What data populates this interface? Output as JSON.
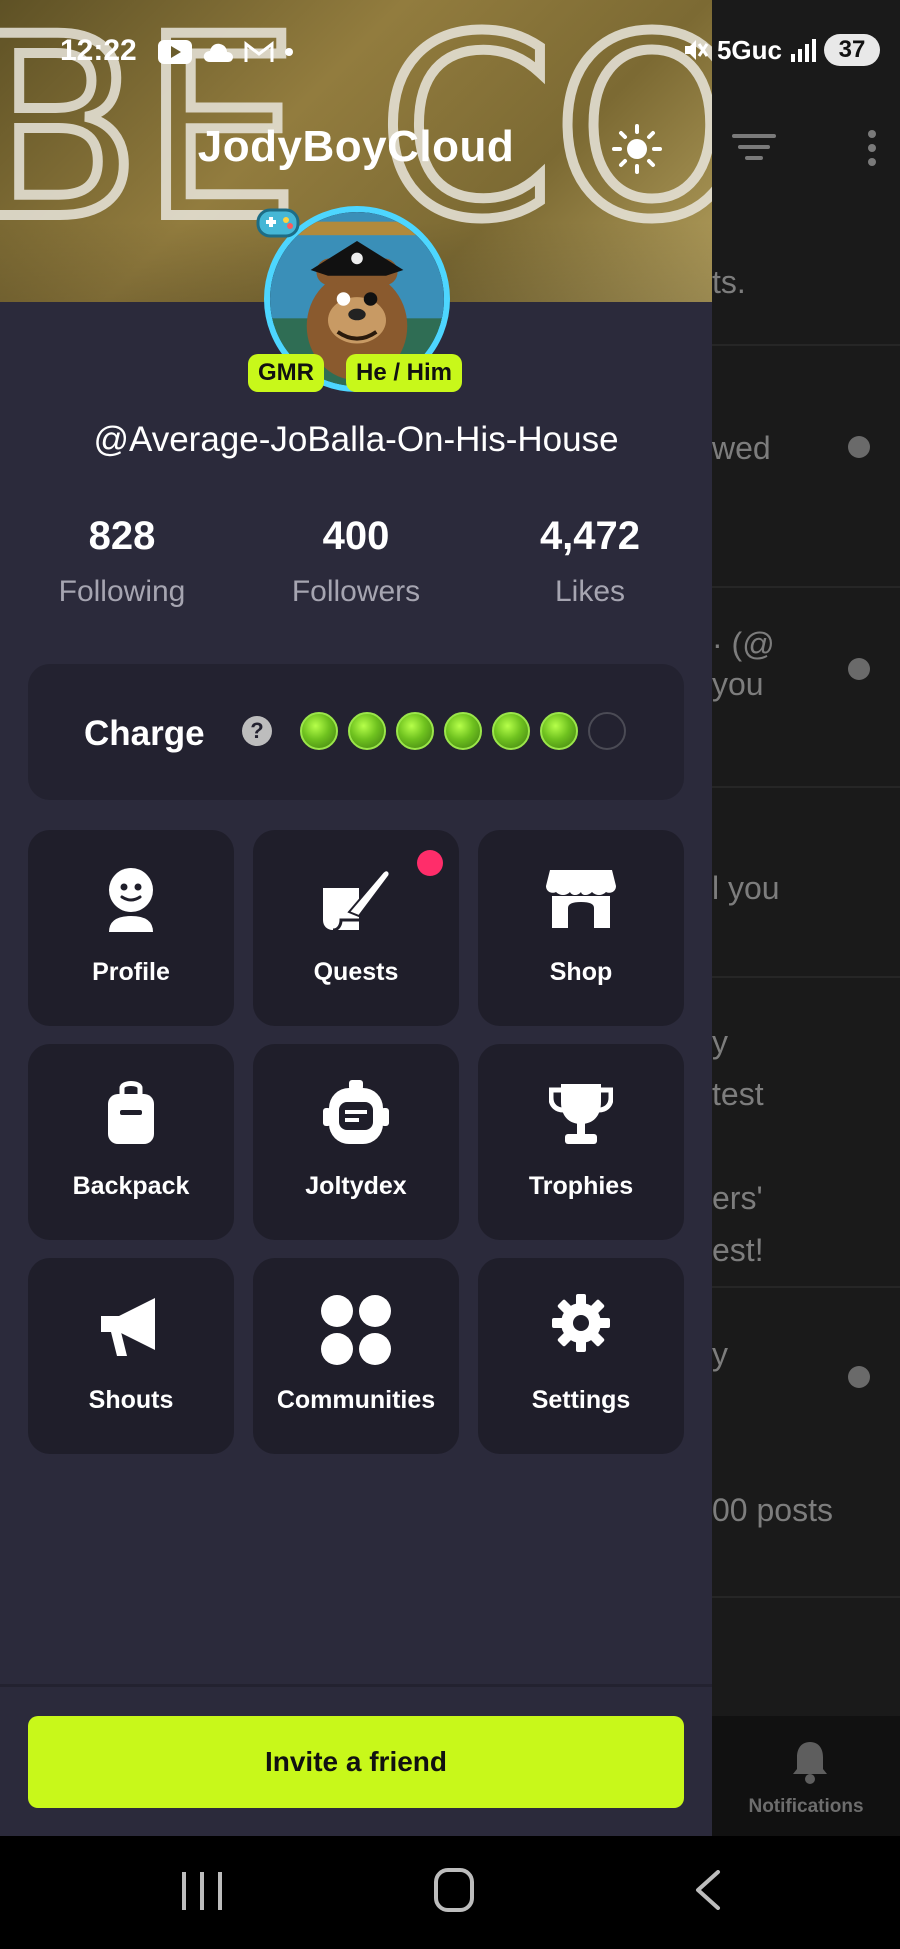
{
  "status_bar": {
    "time": "12:22",
    "network": "5Guc",
    "battery": "37"
  },
  "profile": {
    "display_name": "JodyBoyCloud",
    "handle": "@Average-JoBalla-On-His-House",
    "badges": [
      "GMR",
      "He / Him"
    ],
    "cover_text": "BE COO"
  },
  "stats": [
    {
      "value": "828",
      "label": "Following"
    },
    {
      "value": "400",
      "label": "Followers"
    },
    {
      "value": "4,472",
      "label": "Likes"
    }
  ],
  "charge": {
    "label": "Charge",
    "help_icon": "?",
    "filled": 6,
    "total": 7
  },
  "menu": [
    {
      "label": "Profile",
      "icon": "profile-face-icon"
    },
    {
      "label": "Quests",
      "icon": "quest-scroll-icon",
      "has_notification": true
    },
    {
      "label": "Shop",
      "icon": "store-icon"
    },
    {
      "label": "Backpack",
      "icon": "backpack-icon"
    },
    {
      "label": "Joltydex",
      "icon": "joltydex-device-icon"
    },
    {
      "label": "Trophies",
      "icon": "trophy-icon"
    },
    {
      "label": "Shouts",
      "icon": "megaphone-icon"
    },
    {
      "label": "Communities",
      "icon": "four-circles-icon"
    },
    {
      "label": "Settings",
      "icon": "gear-icon"
    }
  ],
  "invite_button": "Invite a friend",
  "background_feed": {
    "rows": [
      {
        "text": "ts."
      },
      {
        "text": "wed"
      },
      {
        "text": "· (@\nyou"
      },
      {
        "text": "l you"
      },
      {
        "text": "y\ntest\n\ners'\nest!"
      },
      {
        "text": "y\n\n\n00 posts"
      }
    ],
    "nav_label": "Notifications"
  },
  "colors": {
    "accent": "#c8f81a",
    "drawer_bg": "#2b2a3b",
    "tile_bg": "#1f1e2a",
    "notification_dot": "#ff2d6a",
    "avatar_ring": "#4dd6ff"
  }
}
